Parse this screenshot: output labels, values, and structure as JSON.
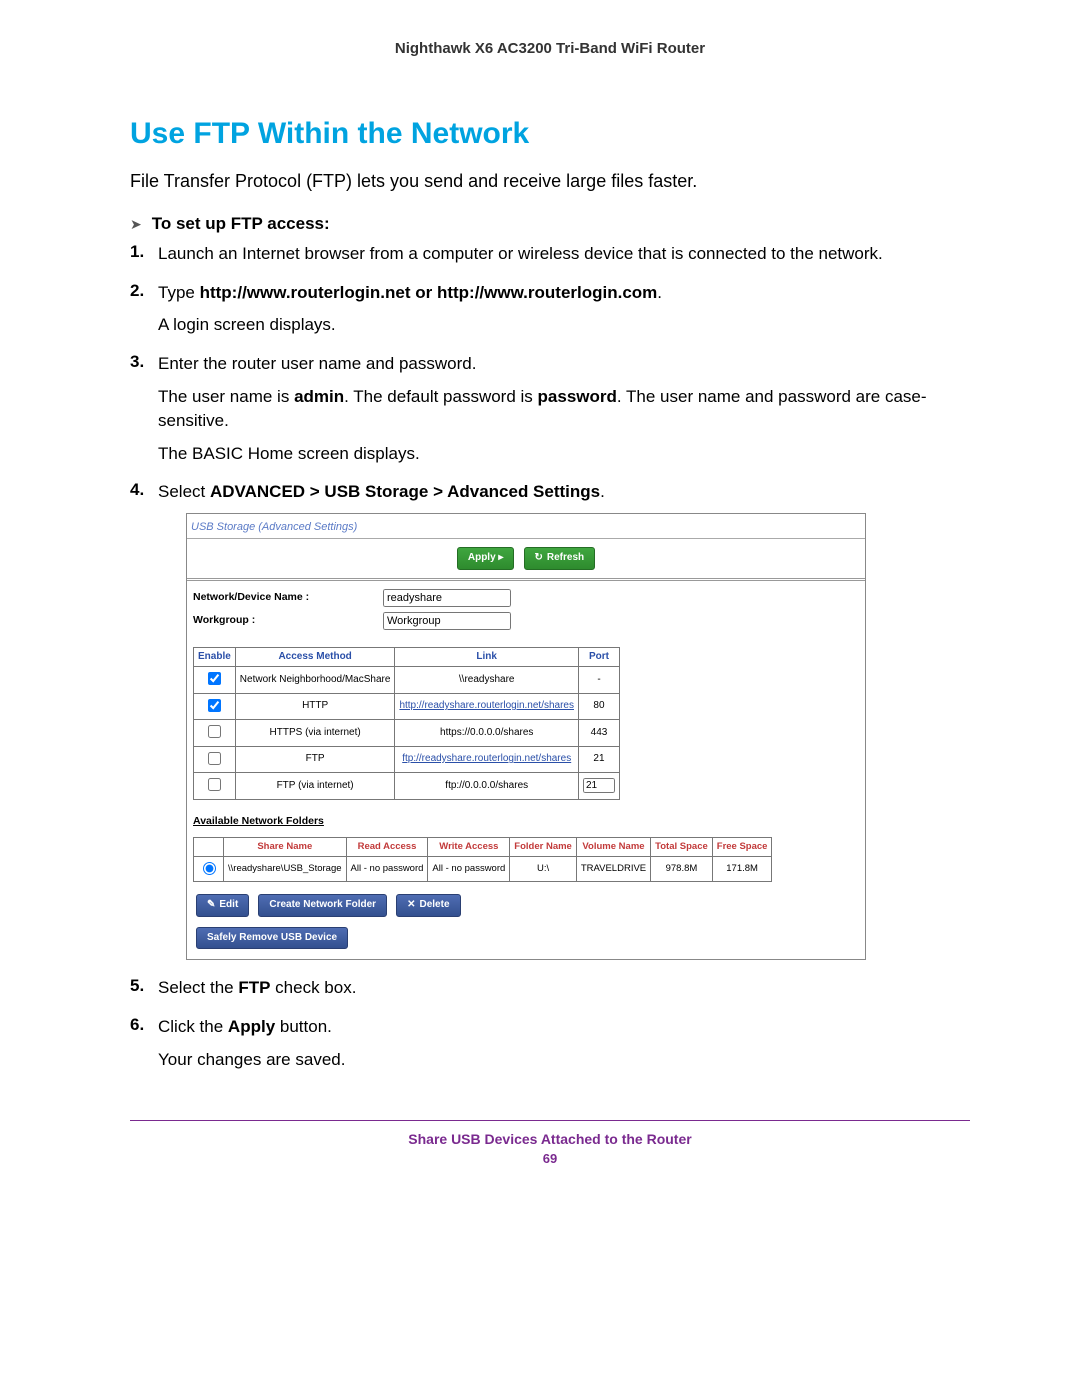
{
  "header": {
    "product": "Nighthawk X6 AC3200 Tri-Band WiFi Router"
  },
  "title": "Use FTP Within the Network",
  "intro": "File Transfer Protocol (FTP) lets you send and receive large files faster.",
  "sub_heading": "To set up FTP access:",
  "steps": {
    "s1": {
      "num": "1.",
      "text": "Launch an Internet browser from a computer or wireless device that is connected to the network."
    },
    "s2": {
      "num": "2.",
      "prefix": "Type ",
      "bold": "http://www.routerlogin.net or http://www.routerlogin.com",
      "suffix": ".",
      "after": "A login screen displays."
    },
    "s3": {
      "num": "3.",
      "text": "Enter the router user name and password.",
      "p2a": "The user name is ",
      "p2b": "admin",
      "p2c": ". The default password is ",
      "p2d": "password",
      "p2e": ". The user name and password are case-sensitive.",
      "p3": "The BASIC Home screen displays."
    },
    "s4": {
      "num": "4.",
      "prefix": "Select ",
      "bold": "ADVANCED > USB Storage > Advanced Settings",
      "suffix": "."
    },
    "s5": {
      "num": "5.",
      "prefix": "Select the ",
      "bold": "FTP",
      "suffix": " check box."
    },
    "s6": {
      "num": "6.",
      "prefix": "Click the ",
      "bold": "Apply",
      "suffix": " button.",
      "after": "Your changes are saved."
    }
  },
  "panel": {
    "title": "USB Storage (Advanced Settings)",
    "buttons": {
      "apply": "Apply ▸",
      "refresh": "Refresh"
    },
    "form": {
      "device_label": "Network/Device Name :",
      "device_value": "readyshare",
      "workgroup_label": "Workgroup :",
      "workgroup_value": "Workgroup"
    },
    "access_headers": {
      "enable": "Enable",
      "method": "Access Method",
      "link": "Link",
      "port": "Port"
    },
    "access": [
      {
        "enabled": true,
        "method": "Network Neighborhood/MacShare",
        "link": "\\\\readyshare",
        "is_link": false,
        "port": "-",
        "port_editable": false
      },
      {
        "enabled": true,
        "method": "HTTP",
        "link": "http://readyshare.routerlogin.net/shares",
        "is_link": true,
        "port": "80",
        "port_editable": false
      },
      {
        "enabled": false,
        "method": "HTTPS (via internet)",
        "link": "https://0.0.0.0/shares",
        "is_link": false,
        "port": "443",
        "port_editable": false
      },
      {
        "enabled": false,
        "method": "FTP",
        "link": "ftp://readyshare.routerlogin.net/shares",
        "is_link": true,
        "port": "21",
        "port_editable": false
      },
      {
        "enabled": false,
        "method": "FTP (via internet)",
        "link": "ftp://0.0.0.0/shares",
        "is_link": false,
        "port": "21",
        "port_editable": true
      }
    ],
    "folders_title": "Available Network Folders",
    "folders_headers": {
      "share": "Share Name",
      "read": "Read Access",
      "write": "Write Access",
      "folder": "Folder Name",
      "volume": "Volume Name",
      "total": "Total Space",
      "free": "Free Space"
    },
    "folders": [
      {
        "share": "\\\\readyshare\\USB_Storage",
        "read": "All - no password",
        "write": "All - no password",
        "folder": "U:\\",
        "volume": "TRAVELDRIVE",
        "total": "978.8M",
        "free": "171.8M"
      }
    ],
    "lower_buttons": {
      "edit": "Edit",
      "create": "Create Network Folder",
      "delete": "Delete",
      "remove": "Safely Remove USB Device"
    }
  },
  "footer": {
    "section": "Share USB Devices Attached to the Router",
    "page": "69"
  }
}
